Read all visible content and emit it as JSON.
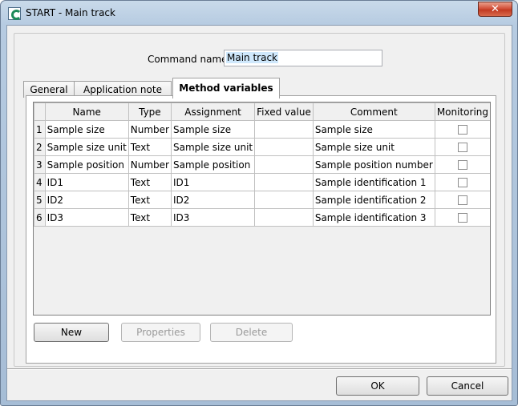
{
  "window": {
    "title": "START - Main track",
    "close_glyph": "✕"
  },
  "command": {
    "label": "Command name",
    "value": "Main track"
  },
  "tabs": [
    {
      "label": "General"
    },
    {
      "label": "Application note"
    },
    {
      "label": "Method variables"
    }
  ],
  "table": {
    "headers": [
      "Name",
      "Type",
      "Assignment",
      "Fixed value",
      "Comment",
      "Monitoring"
    ],
    "rows": [
      {
        "num": "1",
        "name": "Sample size",
        "type": "Number",
        "assignment": "Sample size",
        "fixed": "",
        "comment": "Sample size"
      },
      {
        "num": "2",
        "name": "Sample size unit",
        "type": "Text",
        "assignment": "Sample size unit",
        "fixed": "",
        "comment": "Sample size unit"
      },
      {
        "num": "3",
        "name": "Sample position",
        "type": "Number",
        "assignment": "Sample position",
        "fixed": "",
        "comment": "Sample position number"
      },
      {
        "num": "4",
        "name": "ID1",
        "type": "Text",
        "assignment": "ID1",
        "fixed": "",
        "comment": "Sample identification 1"
      },
      {
        "num": "5",
        "name": "ID2",
        "type": "Text",
        "assignment": "ID2",
        "fixed": "",
        "comment": "Sample identification 2"
      },
      {
        "num": "6",
        "name": "ID3",
        "type": "Text",
        "assignment": "ID3",
        "fixed": "",
        "comment": "Sample identification 3"
      }
    ]
  },
  "buttons": {
    "new": "New",
    "properties": "Properties",
    "delete": "Delete",
    "ok": "OK",
    "cancel": "Cancel"
  }
}
